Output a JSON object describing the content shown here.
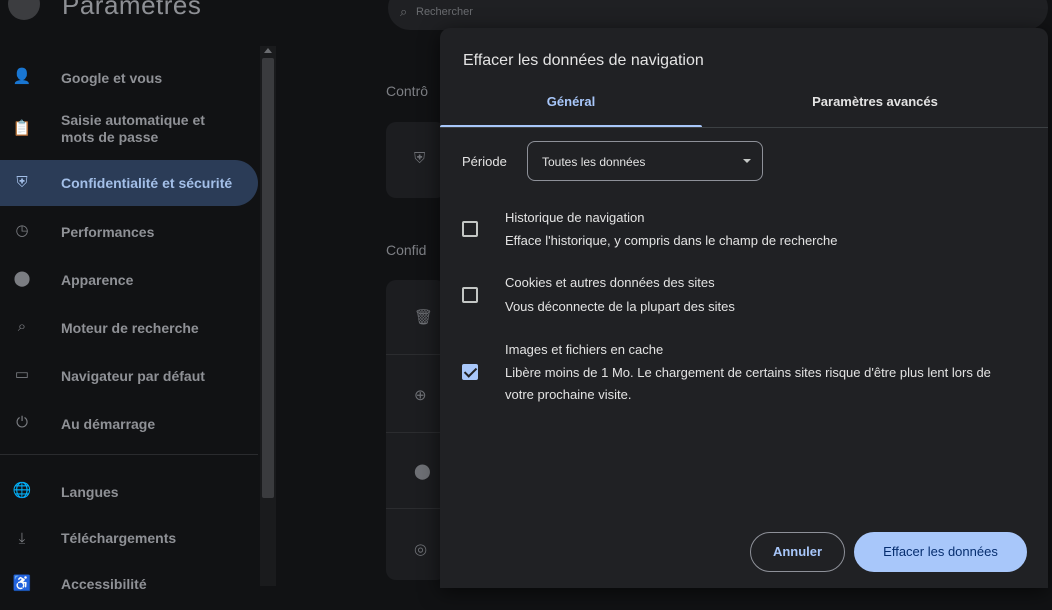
{
  "app": {
    "title": "Paramètres",
    "search_placeholder": "Rechercher"
  },
  "sidebar": {
    "items": [
      {
        "label": "Google et vous",
        "icon": "person-icon"
      },
      {
        "label": "Saisie automatique et mots de passe",
        "icon": "clipboard-icon"
      },
      {
        "label": "Confidentialité et sécurité",
        "icon": "shield-icon",
        "active": true
      },
      {
        "label": "Performances",
        "icon": "speedometer-icon"
      },
      {
        "label": "Apparence",
        "icon": "palette-icon"
      },
      {
        "label": "Moteur de recherche",
        "icon": "search-icon"
      },
      {
        "label": "Navigateur par défaut",
        "icon": "browser-icon"
      },
      {
        "label": "Au démarrage",
        "icon": "power-icon"
      },
      {
        "label": "Langues",
        "icon": "globe-icon"
      },
      {
        "label": "Téléchargements",
        "icon": "download-icon"
      },
      {
        "label": "Accessibilité",
        "icon": "accessibility-icon"
      }
    ]
  },
  "main": {
    "section1": "Contrô",
    "section2": "Confid"
  },
  "dialog": {
    "title": "Effacer les données de navigation",
    "tabs": [
      {
        "label": "Général",
        "active": true
      },
      {
        "label": "Paramètres avancés",
        "active": false
      }
    ],
    "period_label": "Période",
    "period_value": "Toutes les données",
    "options": [
      {
        "title": "Historique de navigation",
        "desc": "Efface l'historique, y compris dans le champ de recherche",
        "checked": false
      },
      {
        "title": "Cookies et autres données des sites",
        "desc": "Vous déconnecte de la plupart des sites",
        "checked": false
      },
      {
        "title": "Images et fichiers en cache",
        "desc": "Libère moins de 1 Mo. Le chargement de certains sites risque d'être plus lent lors de votre prochaine visite.",
        "checked": true
      }
    ],
    "cancel_label": "Annuler",
    "confirm_label": "Effacer les données"
  },
  "colors": {
    "accent": "#a8c7fa",
    "dialog_bg": "#202124",
    "page_bg": "#111214"
  }
}
